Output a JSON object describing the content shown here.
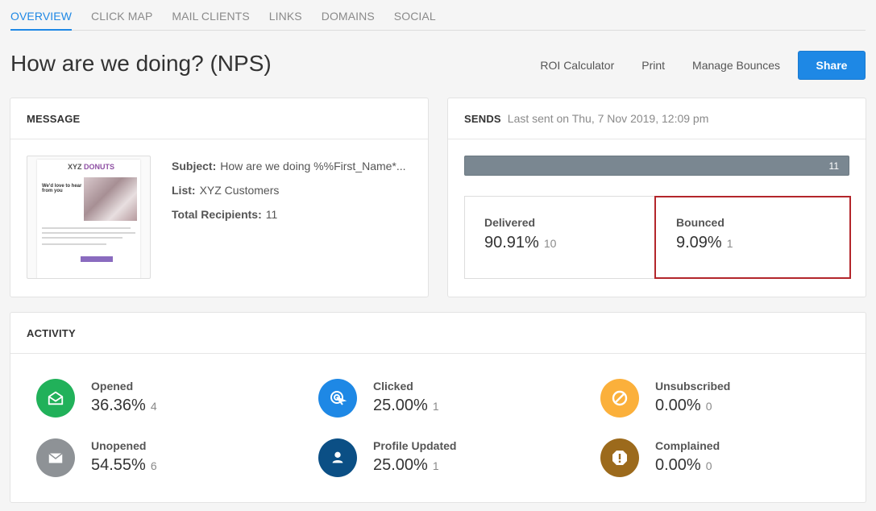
{
  "tabs": [
    {
      "label": "OVERVIEW",
      "active": true
    },
    {
      "label": "CLICK MAP",
      "active": false
    },
    {
      "label": "MAIL CLIENTS",
      "active": false
    },
    {
      "label": "LINKS",
      "active": false
    },
    {
      "label": "DOMAINS",
      "active": false
    },
    {
      "label": "SOCIAL",
      "active": false
    }
  ],
  "header": {
    "title": "How are we doing? (NPS)",
    "actions": {
      "roi": "ROI Calculator",
      "print": "Print",
      "manage_bounces": "Manage Bounces",
      "share": "Share"
    }
  },
  "message": {
    "title": "MESSAGE",
    "subject_label": "Subject:",
    "subject": "How are we doing %%First_Name*...",
    "list_label": "List:",
    "list": "XYZ Customers",
    "recipients_label": "Total Recipients:",
    "recipients": "11",
    "thumbnail": {
      "logo_prefix": "XYZ",
      "logo_brand": "DONUTS",
      "headline": "We'd love to hear from you"
    }
  },
  "sends": {
    "title": "SENDS",
    "last_sent": "Last sent on Thu, 7 Nov 2019, 12:09 pm",
    "bar_count": "11",
    "delivered": {
      "label": "Delivered",
      "pct": "90.91%",
      "count": "10"
    },
    "bounced": {
      "label": "Bounced",
      "pct": "9.09%",
      "count": "1"
    }
  },
  "activity": {
    "title": "ACTIVITY",
    "items": [
      {
        "label": "Opened",
        "pct": "36.36%",
        "count": "4",
        "icon": "envelope-open-icon",
        "color": "#21b15a"
      },
      {
        "label": "Clicked",
        "pct": "25.00%",
        "count": "1",
        "icon": "cursor-click-icon",
        "color": "#1e88e5"
      },
      {
        "label": "Unsubscribed",
        "pct": "0.00%",
        "count": "0",
        "icon": "block-icon",
        "color": "#fbb03b"
      },
      {
        "label": "Unopened",
        "pct": "54.55%",
        "count": "6",
        "icon": "envelope-closed-icon",
        "color": "#8e9296"
      },
      {
        "label": "Profile Updated",
        "pct": "25.00%",
        "count": "1",
        "icon": "person-icon",
        "color": "#0b4f85"
      },
      {
        "label": "Complained",
        "pct": "0.00%",
        "count": "0",
        "icon": "exclamation-icon",
        "color": "#9c6a1c"
      }
    ]
  }
}
